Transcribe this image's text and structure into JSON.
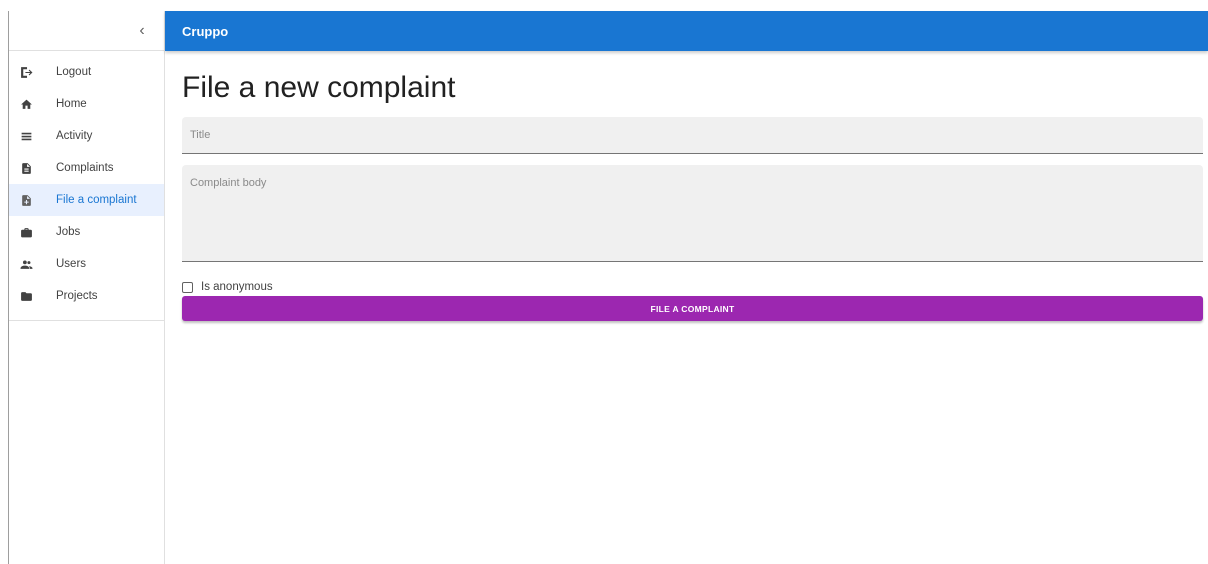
{
  "appbar": {
    "title": "Cruppo"
  },
  "drawer": {
    "collapse_icon": "chevron-left-icon",
    "collapse_glyph": "‹",
    "items": [
      {
        "label": "Logout",
        "icon": "logout-icon",
        "active": false
      },
      {
        "label": "Home",
        "icon": "home-icon",
        "active": false
      },
      {
        "label": "Activity",
        "icon": "list-icon",
        "active": false
      },
      {
        "label": "Complaints",
        "icon": "document-icon",
        "active": false
      },
      {
        "label": "File a complaint",
        "icon": "document-add-icon",
        "active": true
      },
      {
        "label": "Jobs",
        "icon": "briefcase-icon",
        "active": false
      },
      {
        "label": "Users",
        "icon": "people-icon",
        "active": false
      },
      {
        "label": "Projects",
        "icon": "folder-icon",
        "active": false
      }
    ]
  },
  "main": {
    "title": "File a new complaint",
    "title_field": {
      "placeholder": "Title",
      "value": ""
    },
    "body_field": {
      "placeholder": "Complaint body",
      "value": ""
    },
    "anonymous_checkbox": {
      "label": "Is anonymous",
      "checked": false
    },
    "submit_label": "FILE A COMPLAINT"
  },
  "colors": {
    "appbar": "#1976d2",
    "active_nav_bg": "#e8f0fe",
    "active_nav_text": "#1976d2",
    "submit_button": "#9c27b0",
    "field_bg": "#f0f0f0"
  }
}
